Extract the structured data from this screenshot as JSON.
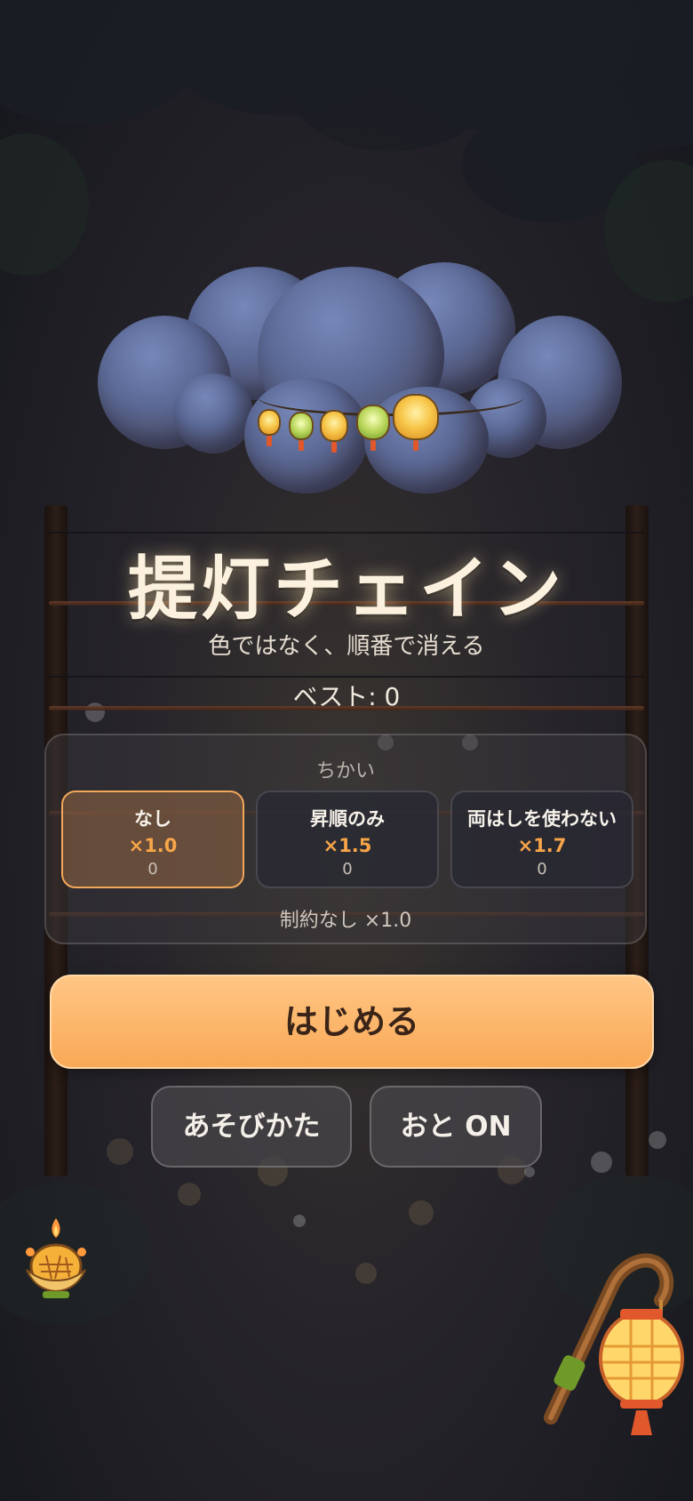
{
  "game": {
    "title": "提灯チェイン",
    "subtitle": "色ではなく、順番で消える",
    "best_label": "ベスト: 0"
  },
  "pledge": {
    "heading": "ちかい",
    "options": [
      {
        "label": "なし",
        "multiplier": "×1.0",
        "count": "0",
        "selected": true
      },
      {
        "label": "昇順のみ",
        "multiplier": "×1.5",
        "count": "0",
        "selected": false
      },
      {
        "label": "両はしを使わない",
        "multiplier": "×1.7",
        "count": "0",
        "selected": false
      }
    ],
    "note": "制約なし ×1.0"
  },
  "buttons": {
    "start": "はじめる",
    "howto": "あそびかた",
    "sound": "おと ON"
  },
  "colors": {
    "accent": "#f9a856",
    "accent_text": "#f7a548",
    "selected_border": "#f2a85b"
  }
}
